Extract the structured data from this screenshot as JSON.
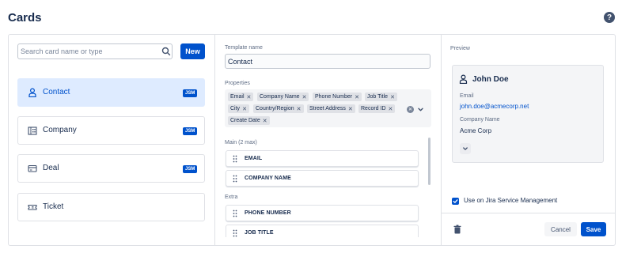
{
  "page": {
    "title": "Cards",
    "help_icon": "question-circle-icon"
  },
  "search": {
    "placeholder": "Search card name or type",
    "value": "",
    "icon": "search-icon"
  },
  "toolbar": {
    "new_label": "New"
  },
  "cards": [
    {
      "label": "Contact",
      "icon": "person-icon",
      "badge": "JSM",
      "selected": true
    },
    {
      "label": "Company",
      "icon": "building-icon",
      "badge": "JSM",
      "selected": false
    },
    {
      "label": "Deal",
      "icon": "credit-card-icon",
      "badge": "JSM",
      "selected": false
    },
    {
      "label": "Ticket",
      "icon": "ticket-icon",
      "badge": "",
      "selected": false
    }
  ],
  "template": {
    "name_label": "Template name",
    "name_value": "Contact",
    "properties_label": "Properties",
    "properties": [
      "Email",
      "Company Name",
      "Phone Number",
      "Job Title",
      "City",
      "Country/Region",
      "Street Address",
      "Record ID",
      "Create Date"
    ],
    "main_label": "Main (2 max)",
    "main_fields": [
      "EMAIL",
      "COMPANY NAME"
    ],
    "extra_label": "Extra",
    "extra_fields": [
      "PHONE NUMBER",
      "JOB TITLE"
    ]
  },
  "preview": {
    "label": "Preview",
    "name": "John Doe",
    "email_label": "Email",
    "email_value": "john.doe@acmecorp.net",
    "company_label": "Company Name",
    "company_value": "Acme Corp"
  },
  "settings": {
    "jsm_label": "Use on Jira Service Management",
    "jsm_checked": true
  },
  "actions": {
    "cancel_label": "Cancel",
    "save_label": "Save"
  },
  "colors": {
    "primary": "#0052cc",
    "selected_bg": "#deebff",
    "text": "#172b4d",
    "muted": "#5e6c84",
    "border": "#dfe1e6"
  }
}
